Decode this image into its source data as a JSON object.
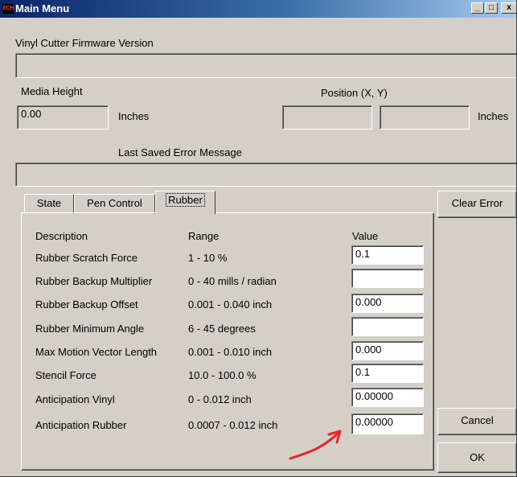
{
  "window": {
    "title": "Main Menu",
    "icon_text": "ECH",
    "min_glyph": "_",
    "max_glyph": "□",
    "close_glyph": "x"
  },
  "firmware": {
    "label": "Vinyl Cutter Firmware Version",
    "value": ""
  },
  "media": {
    "label": "Media Height",
    "value": "0.00",
    "unit": "Inches"
  },
  "position": {
    "label": "Position (X, Y)",
    "x": "",
    "y": "",
    "unit": "Inches"
  },
  "error": {
    "label": "Last Saved Error Message",
    "value": ""
  },
  "tabs": [
    {
      "label": "State",
      "active": false
    },
    {
      "label": "Pen Control",
      "active": false
    },
    {
      "label": "Rubber",
      "active": true
    }
  ],
  "table": {
    "headers": {
      "description": "Description",
      "range": "Range",
      "value": "Value"
    },
    "rows": [
      {
        "description": "Rubber Scratch Force",
        "range": "1 - 10 %",
        "value": "0.1"
      },
      {
        "description": "Rubber Backup Multiplier",
        "range": "0 - 40 mills / radian",
        "value": ""
      },
      {
        "description": "Rubber Backup Offset",
        "range": "0.001 - 0.040 inch",
        "value": "0.000"
      },
      {
        "description": "Rubber Minimum Angle",
        "range": "6 - 45 degrees",
        "value": ""
      },
      {
        "description": "Max Motion Vector Length",
        "range": "0.001 - 0.010 inch",
        "value": "0.000"
      },
      {
        "description": "Stencil Force",
        "range": "10.0 - 100.0 %",
        "value": "0.1"
      },
      {
        "description": "Anticipation Vinyl",
        "range": "0 - 0.012 inch",
        "value": "0.00000"
      },
      {
        "description": "Anticipation Rubber",
        "range": "0.0007 - 0.012 inch",
        "value": "0.00000"
      }
    ]
  },
  "buttons": {
    "clear_error": "Clear Error",
    "cancel": "Cancel",
    "ok": "OK"
  },
  "colors": {
    "titlebar": "#0a246a",
    "arrow": "#e8262a",
    "face": "#d4d0c8"
  },
  "annotation": {
    "arrow_icon": "red-arrow-annotation"
  }
}
